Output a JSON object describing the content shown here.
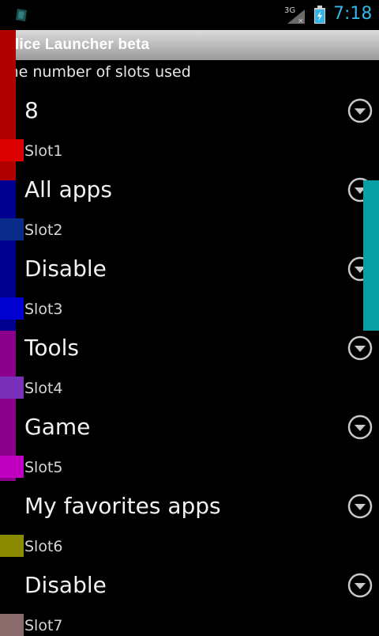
{
  "status_bar": {
    "time": "7:18",
    "network_label": "3G",
    "icons": [
      "app-notification-icon",
      "signal-3g-icon",
      "battery-charging-icon"
    ]
  },
  "app": {
    "title": "Slice Launcher beta",
    "subtitle": "The number of slots used"
  },
  "items": [
    {
      "value": "8",
      "slot": "Slot1"
    },
    {
      "value": "All apps",
      "slot": "Slot2"
    },
    {
      "value": "Disable",
      "slot": "Slot3"
    },
    {
      "value": "Tools",
      "slot": "Slot4"
    },
    {
      "value": "Game",
      "slot": "Slot5"
    },
    {
      "value": "My favorites apps",
      "slot": "Slot6"
    },
    {
      "value": "Disable",
      "slot": "Slot7"
    }
  ],
  "colors": {
    "accent": "#33b5e5",
    "scrollbar": "#0a9fa2",
    "slot_strips": [
      "#b00000",
      "#000090",
      "#000090",
      "#8a008a",
      "#8a008a",
      "#000000",
      "#000000"
    ],
    "slot_chips": [
      "#dd0000",
      "#0b2b8a",
      "#0000d0",
      "#7a2fb8",
      "#c000c0",
      "#8a8a00",
      "#8a6a6a"
    ]
  }
}
